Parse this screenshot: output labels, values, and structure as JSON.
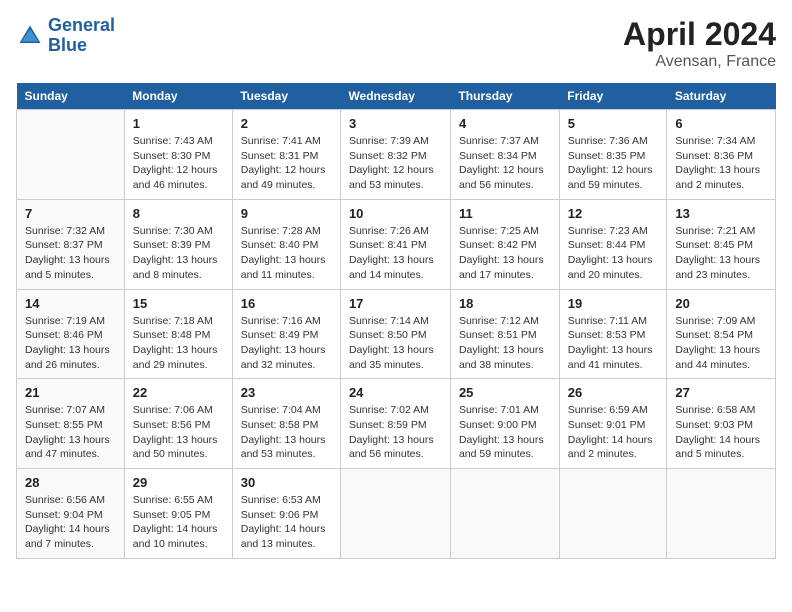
{
  "logo": {
    "text_general": "General",
    "text_blue": "Blue"
  },
  "title": "April 2024",
  "subtitle": "Avensan, France",
  "days_of_week": [
    "Sunday",
    "Monday",
    "Tuesday",
    "Wednesday",
    "Thursday",
    "Friday",
    "Saturday"
  ],
  "weeks": [
    [
      {
        "day": "",
        "sunrise": "",
        "sunset": "",
        "daylight": ""
      },
      {
        "day": "1",
        "sunrise": "Sunrise: 7:43 AM",
        "sunset": "Sunset: 8:30 PM",
        "daylight": "Daylight: 12 hours and 46 minutes."
      },
      {
        "day": "2",
        "sunrise": "Sunrise: 7:41 AM",
        "sunset": "Sunset: 8:31 PM",
        "daylight": "Daylight: 12 hours and 49 minutes."
      },
      {
        "day": "3",
        "sunrise": "Sunrise: 7:39 AM",
        "sunset": "Sunset: 8:32 PM",
        "daylight": "Daylight: 12 hours and 53 minutes."
      },
      {
        "day": "4",
        "sunrise": "Sunrise: 7:37 AM",
        "sunset": "Sunset: 8:34 PM",
        "daylight": "Daylight: 12 hours and 56 minutes."
      },
      {
        "day": "5",
        "sunrise": "Sunrise: 7:36 AM",
        "sunset": "Sunset: 8:35 PM",
        "daylight": "Daylight: 12 hours and 59 minutes."
      },
      {
        "day": "6",
        "sunrise": "Sunrise: 7:34 AM",
        "sunset": "Sunset: 8:36 PM",
        "daylight": "Daylight: 13 hours and 2 minutes."
      }
    ],
    [
      {
        "day": "7",
        "sunrise": "Sunrise: 7:32 AM",
        "sunset": "Sunset: 8:37 PM",
        "daylight": "Daylight: 13 hours and 5 minutes."
      },
      {
        "day": "8",
        "sunrise": "Sunrise: 7:30 AM",
        "sunset": "Sunset: 8:39 PM",
        "daylight": "Daylight: 13 hours and 8 minutes."
      },
      {
        "day": "9",
        "sunrise": "Sunrise: 7:28 AM",
        "sunset": "Sunset: 8:40 PM",
        "daylight": "Daylight: 13 hours and 11 minutes."
      },
      {
        "day": "10",
        "sunrise": "Sunrise: 7:26 AM",
        "sunset": "Sunset: 8:41 PM",
        "daylight": "Daylight: 13 hours and 14 minutes."
      },
      {
        "day": "11",
        "sunrise": "Sunrise: 7:25 AM",
        "sunset": "Sunset: 8:42 PM",
        "daylight": "Daylight: 13 hours and 17 minutes."
      },
      {
        "day": "12",
        "sunrise": "Sunrise: 7:23 AM",
        "sunset": "Sunset: 8:44 PM",
        "daylight": "Daylight: 13 hours and 20 minutes."
      },
      {
        "day": "13",
        "sunrise": "Sunrise: 7:21 AM",
        "sunset": "Sunset: 8:45 PM",
        "daylight": "Daylight: 13 hours and 23 minutes."
      }
    ],
    [
      {
        "day": "14",
        "sunrise": "Sunrise: 7:19 AM",
        "sunset": "Sunset: 8:46 PM",
        "daylight": "Daylight: 13 hours and 26 minutes."
      },
      {
        "day": "15",
        "sunrise": "Sunrise: 7:18 AM",
        "sunset": "Sunset: 8:48 PM",
        "daylight": "Daylight: 13 hours and 29 minutes."
      },
      {
        "day": "16",
        "sunrise": "Sunrise: 7:16 AM",
        "sunset": "Sunset: 8:49 PM",
        "daylight": "Daylight: 13 hours and 32 minutes."
      },
      {
        "day": "17",
        "sunrise": "Sunrise: 7:14 AM",
        "sunset": "Sunset: 8:50 PM",
        "daylight": "Daylight: 13 hours and 35 minutes."
      },
      {
        "day": "18",
        "sunrise": "Sunrise: 7:12 AM",
        "sunset": "Sunset: 8:51 PM",
        "daylight": "Daylight: 13 hours and 38 minutes."
      },
      {
        "day": "19",
        "sunrise": "Sunrise: 7:11 AM",
        "sunset": "Sunset: 8:53 PM",
        "daylight": "Daylight: 13 hours and 41 minutes."
      },
      {
        "day": "20",
        "sunrise": "Sunrise: 7:09 AM",
        "sunset": "Sunset: 8:54 PM",
        "daylight": "Daylight: 13 hours and 44 minutes."
      }
    ],
    [
      {
        "day": "21",
        "sunrise": "Sunrise: 7:07 AM",
        "sunset": "Sunset: 8:55 PM",
        "daylight": "Daylight: 13 hours and 47 minutes."
      },
      {
        "day": "22",
        "sunrise": "Sunrise: 7:06 AM",
        "sunset": "Sunset: 8:56 PM",
        "daylight": "Daylight: 13 hours and 50 minutes."
      },
      {
        "day": "23",
        "sunrise": "Sunrise: 7:04 AM",
        "sunset": "Sunset: 8:58 PM",
        "daylight": "Daylight: 13 hours and 53 minutes."
      },
      {
        "day": "24",
        "sunrise": "Sunrise: 7:02 AM",
        "sunset": "Sunset: 8:59 PM",
        "daylight": "Daylight: 13 hours and 56 minutes."
      },
      {
        "day": "25",
        "sunrise": "Sunrise: 7:01 AM",
        "sunset": "Sunset: 9:00 PM",
        "daylight": "Daylight: 13 hours and 59 minutes."
      },
      {
        "day": "26",
        "sunrise": "Sunrise: 6:59 AM",
        "sunset": "Sunset: 9:01 PM",
        "daylight": "Daylight: 14 hours and 2 minutes."
      },
      {
        "day": "27",
        "sunrise": "Sunrise: 6:58 AM",
        "sunset": "Sunset: 9:03 PM",
        "daylight": "Daylight: 14 hours and 5 minutes."
      }
    ],
    [
      {
        "day": "28",
        "sunrise": "Sunrise: 6:56 AM",
        "sunset": "Sunset: 9:04 PM",
        "daylight": "Daylight: 14 hours and 7 minutes."
      },
      {
        "day": "29",
        "sunrise": "Sunrise: 6:55 AM",
        "sunset": "Sunset: 9:05 PM",
        "daylight": "Daylight: 14 hours and 10 minutes."
      },
      {
        "day": "30",
        "sunrise": "Sunrise: 6:53 AM",
        "sunset": "Sunset: 9:06 PM",
        "daylight": "Daylight: 14 hours and 13 minutes."
      },
      {
        "day": "",
        "sunrise": "",
        "sunset": "",
        "daylight": ""
      },
      {
        "day": "",
        "sunrise": "",
        "sunset": "",
        "daylight": ""
      },
      {
        "day": "",
        "sunrise": "",
        "sunset": "",
        "daylight": ""
      },
      {
        "day": "",
        "sunrise": "",
        "sunset": "",
        "daylight": ""
      }
    ]
  ]
}
